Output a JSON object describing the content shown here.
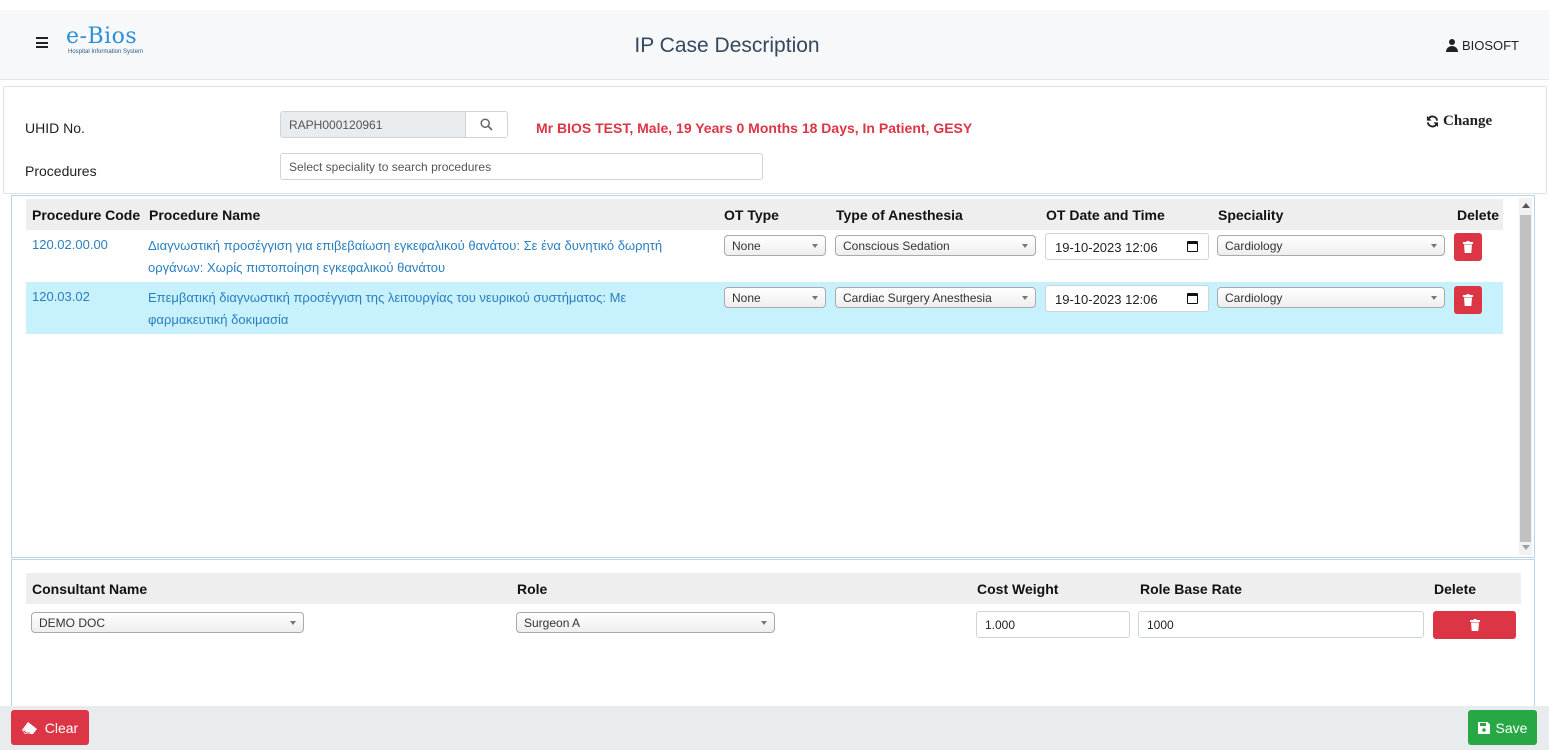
{
  "header": {
    "logo_text": "e-Bios",
    "logo_subtext": "Hospital Information System",
    "title": "IP Case Description",
    "user": "BIOSOFT"
  },
  "patient": {
    "uhid_label": "UHID No.",
    "uhid_value": "RAPH000120961",
    "info": "Mr BIOS TEST, Male, 19 Years 0 Months 18 Days, In Patient, GESY",
    "change_label": "Change",
    "procedures_label": "Procedures",
    "procedures_placeholder": "Select speciality to search procedures"
  },
  "procedures": {
    "columns": [
      "Procedure Code",
      "Procedure Name",
      "OT Type",
      "Type of Anesthesia",
      "OT Date and Time",
      "Speciality",
      "Delete"
    ],
    "rows": [
      {
        "code": "120.02.00.00",
        "name": "Διαγνωστική προσέγγιση για επιβεβαίωση εγκεφαλικού θανάτου: Σε ένα δυνητικό δωρητή οργάνων: Χωρίς πιστοποίηση εγκεφαλικού θανάτου",
        "ot_type": "None",
        "anesthesia": "Conscious Sedation",
        "datetime": "19-10-2023 12:06",
        "speciality": "Cardiology"
      },
      {
        "code": "120.03.02",
        "name": "Επεμβατική διαγνωστική προσέγγιση της λειτουργίας του νευρικού συστήματος: Με φαρμακευτική δοκιμασία",
        "ot_type": "None",
        "anesthesia": "Cardiac Surgery Anesthesia",
        "datetime": "19-10-2023 12:06",
        "speciality": "Cardiology"
      }
    ]
  },
  "consultants": {
    "columns": [
      "Consultant Name",
      "Role",
      "Cost Weight",
      "Role Base Rate",
      "Delete"
    ],
    "rows": [
      {
        "name": "DEMO DOC",
        "role": "Surgeon A",
        "cost_weight": "1.000",
        "base_rate": "1000"
      }
    ]
  },
  "footer": {
    "clear_label": "Clear",
    "save_label": "Save"
  },
  "colors": {
    "danger": "#dc3545",
    "success": "#28a745",
    "link": "#2a7fc0",
    "selected_row": "#c7f1fc"
  }
}
